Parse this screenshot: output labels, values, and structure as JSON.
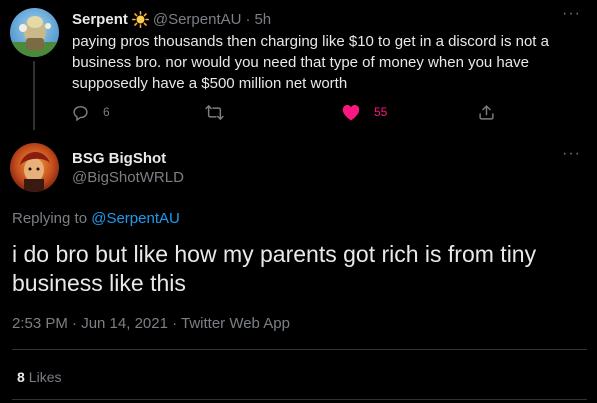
{
  "parent_tweet": {
    "display_name": "Serpent",
    "badge_icon": "sun-emoji",
    "handle": "@SerpentAU",
    "time_separator": "·",
    "time": "5h",
    "text": "paying pros thousands then charging like $10 to get in a discord is not a business bro. nor would you need that type of money when you have supposedly have a $500 million net worth",
    "reply_count": "6",
    "retweet_count": "",
    "like_count": "55",
    "like_color": "#f91880"
  },
  "main_tweet": {
    "display_name": "BSG BigShot",
    "handle": "@BigShotWRLD",
    "replying_prefix": "Replying to ",
    "replying_mention": "@SerpentAU",
    "text": "i do bro but like how my parents got rich is from tiny business like this",
    "meta": "2:53 PM · Jun 14, 2021 · Twitter Web App",
    "likes_count": "8",
    "likes_label": "Likes"
  },
  "more_glyph": "···",
  "colors": {
    "background": "#000000",
    "primary_text": "#e7e9ea",
    "secondary_text": "#7b7f84",
    "link": "#1d9bf0",
    "divider": "#2f3336"
  }
}
